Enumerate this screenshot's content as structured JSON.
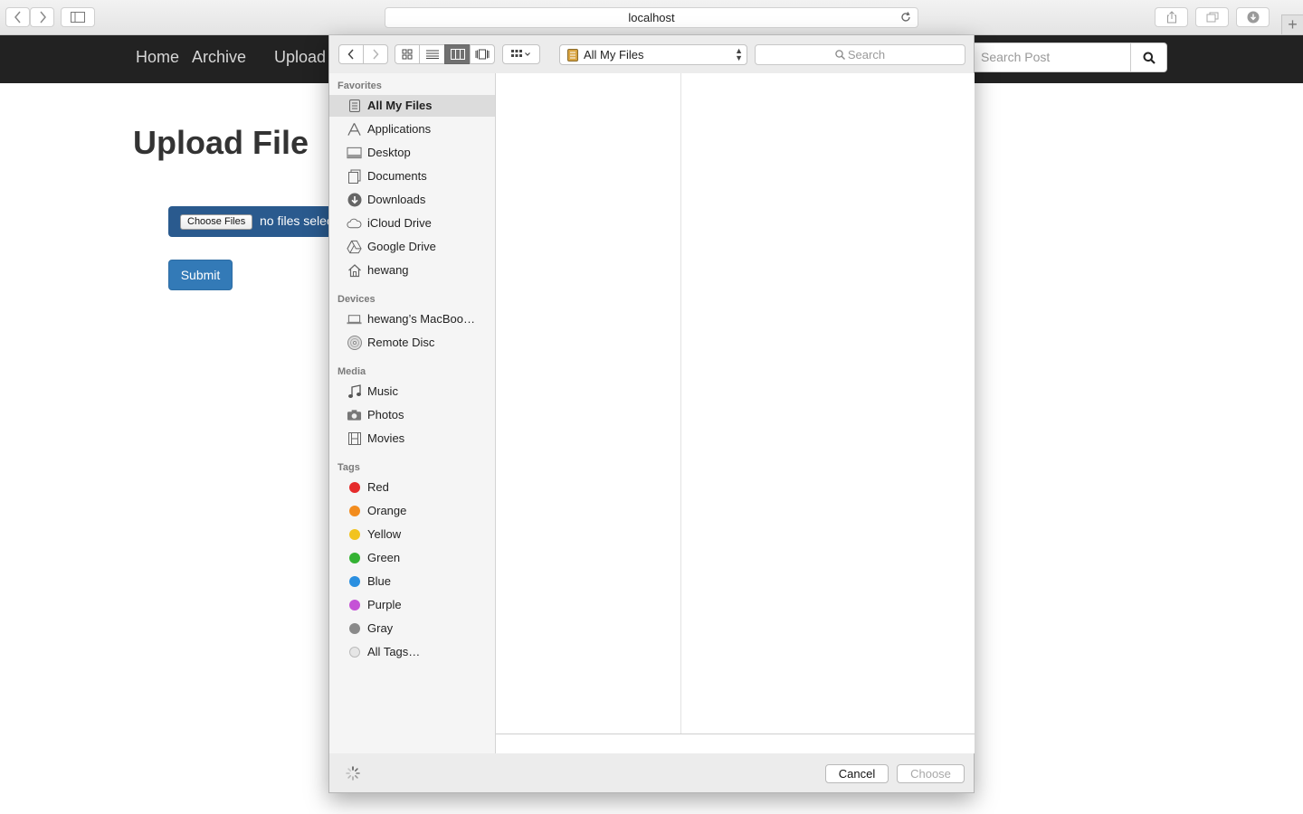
{
  "browser": {
    "url": "localhost",
    "new_tab_label": "+"
  },
  "site": {
    "nav": {
      "home": "Home",
      "archive": "Archive",
      "upload": "Upload"
    },
    "search_placeholder": "Search Post",
    "page_title": "Upload File",
    "choose_files_label": "Choose Files",
    "no_files_text": "no files selected",
    "submit_label": "Submit"
  },
  "dialog": {
    "location": "All My Files",
    "search_placeholder": "Search",
    "sections": {
      "favorites": "Favorites",
      "devices": "Devices",
      "media": "Media",
      "tags": "Tags"
    },
    "favorites": [
      {
        "label": "All My Files",
        "icon": "all-my-files-icon",
        "selected": true
      },
      {
        "label": "Applications",
        "icon": "applications-icon"
      },
      {
        "label": "Desktop",
        "icon": "desktop-icon"
      },
      {
        "label": "Documents",
        "icon": "documents-icon"
      },
      {
        "label": "Downloads",
        "icon": "downloads-icon"
      },
      {
        "label": "iCloud Drive",
        "icon": "icloud-icon"
      },
      {
        "label": "Google Drive",
        "icon": "google-drive-icon"
      },
      {
        "label": "hewang",
        "icon": "home-icon"
      }
    ],
    "devices": [
      {
        "label": "hewang’s MacBoo…",
        "icon": "laptop-icon"
      },
      {
        "label": "Remote Disc",
        "icon": "disc-icon"
      }
    ],
    "media": [
      {
        "label": "Music",
        "icon": "music-icon"
      },
      {
        "label": "Photos",
        "icon": "camera-icon"
      },
      {
        "label": "Movies",
        "icon": "film-icon"
      }
    ],
    "tags": [
      {
        "label": "Red",
        "color": "#e52b2b"
      },
      {
        "label": "Orange",
        "color": "#f28c1e"
      },
      {
        "label": "Yellow",
        "color": "#f2c31e"
      },
      {
        "label": "Green",
        "color": "#34b233"
      },
      {
        "label": "Blue",
        "color": "#2a8fe0"
      },
      {
        "label": "Purple",
        "color": "#c552d6"
      },
      {
        "label": "Gray",
        "color": "#8a8a8a"
      },
      {
        "label": "All Tags…",
        "color": "#dcdcdc"
      }
    ],
    "cancel_label": "Cancel",
    "choose_label": "Choose"
  },
  "colors": {
    "navbar": "#222222",
    "primary": "#337ab7",
    "file_input_bg": "#2a5a8e"
  }
}
